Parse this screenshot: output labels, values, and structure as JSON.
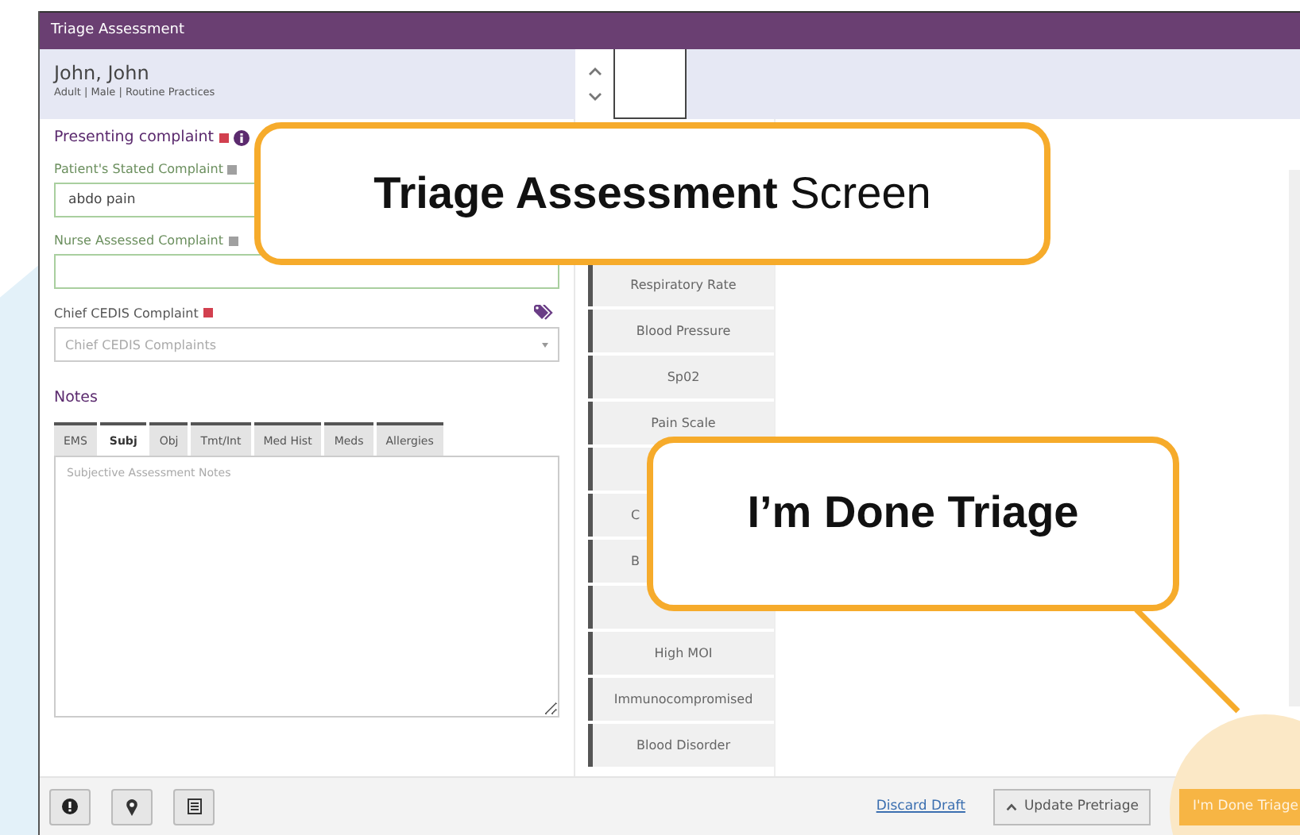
{
  "window": {
    "title": "Triage Assessment"
  },
  "patient": {
    "name": "John, John",
    "details": "Adult | Male | Routine Practices"
  },
  "presenting_complaint": {
    "heading": "Presenting complaint",
    "required": true,
    "fields": [
      {
        "label": "Patient's Stated Complaint",
        "required": false,
        "kind": "text",
        "value": "abdo pain"
      },
      {
        "label": "Nurse Assessed Complaint",
        "required": false,
        "kind": "text"
      },
      {
        "label": "Chief CEDIS Complaint",
        "required": true,
        "kind": "select",
        "placeholder": "Chief CEDIS Complaints"
      }
    ]
  },
  "notes": {
    "heading": "Notes",
    "placeholder": "Subjective Assessment Notes",
    "tabs": [
      {
        "label": "EMS",
        "selected": false
      },
      {
        "label": "Subj",
        "selected": true
      },
      {
        "label": "Obj",
        "selected": false
      },
      {
        "label": "Tmt/Int",
        "selected": false
      },
      {
        "label": "Med Hist",
        "selected": false
      },
      {
        "label": "Meds",
        "selected": false
      },
      {
        "label": "Allergies",
        "selected": false
      }
    ]
  },
  "vitals": [
    {
      "kind": "full",
      "label": "Respiratory Rate"
    },
    {
      "kind": "full",
      "label": "Blood Pressure"
    },
    {
      "kind": "full",
      "label": "Sp02"
    },
    {
      "kind": "full",
      "label": "Pain Scale"
    },
    {
      "kind": "blank"
    },
    {
      "kind": "partial",
      "label": "C"
    },
    {
      "kind": "partial",
      "label": "B"
    },
    {
      "kind": "blank"
    },
    {
      "kind": "full",
      "label": "High MOI"
    },
    {
      "kind": "full",
      "label": "Immunocompromised"
    },
    {
      "kind": "full",
      "label": "Blood Disorder"
    }
  ],
  "footer": {
    "discard_link": "Discard Draft",
    "update_button": "Update Pretriage",
    "done_button": "I'm Done Triage"
  },
  "callouts": [
    {
      "kind": "title",
      "text": "**Triage Assessment** Screen"
    },
    {
      "kind": "pointer",
      "text": "I’m Done Triage"
    }
  ]
}
